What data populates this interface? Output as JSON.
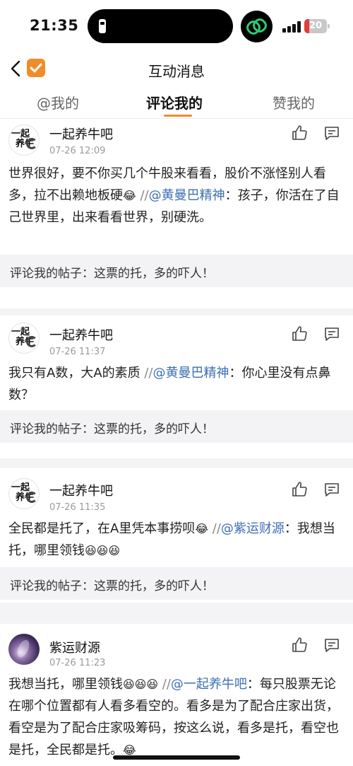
{
  "status_bar": {
    "time": "21:35",
    "battery": "20",
    "battery_level": 0.2,
    "colors": {
      "battery_low": "#e43b3b",
      "app_icon": "#2ecc71"
    }
  },
  "header": {
    "title": "互动消息",
    "back_icon": "chevron-left-icon",
    "app_icon": "checkbox-logo-icon"
  },
  "tabs": [
    {
      "label": "@我的",
      "active": false
    },
    {
      "label": "评论我的",
      "active": true
    },
    {
      "label": "赞我的",
      "active": false
    }
  ],
  "accent_color": "#f08c2a",
  "mention_color": "#3d6fb6",
  "comments": [
    {
      "username": "一起养牛吧",
      "time": "07-26 12:09",
      "text_1": "世界很好，要不你买几个牛股来看看，股价不涨怪别人看多，拉不出赖地板硬",
      "separator": "//",
      "mention": "@黄曼巴精神",
      "text_2": "：孩子，你活在了自己世界里，出来看看世界，别硬洗。",
      "quote": "评论我的帖子：这票的托，多的吓人！"
    },
    {
      "username": "一起养牛吧",
      "time": "07-26 11:37",
      "text_1": "我只有A数，大A的素质 ",
      "separator": "//",
      "mention": "@黄曼巴精神",
      "text_2": "：你心里没有点鼻数？",
      "quote": "评论我的帖子：这票的托，多的吓人！"
    },
    {
      "username": "一起养牛吧",
      "time": "07-26 11:35",
      "text_1": "全民都是托了，在A里凭本事捞呗",
      "separator": "//",
      "mention": "@紫运财源",
      "text_2": "：我想当托，哪里领钱",
      "quote": "评论我的帖子：这票的托，多的吓人！"
    },
    {
      "username": "紫运财源",
      "time": "07-26 11:23",
      "text_1": "我想当托，哪里领钱",
      "separator": "//",
      "mention": "@一起养牛吧",
      "text_2": "：每只股票无论在哪个位置都有人看多看空的。看多是为了配合庄家出货，看空是为了配合庄家吸筹码，按这么说，看多是托，看空也是托，全民都是托。"
    }
  ],
  "avatar_lines": [
    "一起",
    "养牛"
  ]
}
